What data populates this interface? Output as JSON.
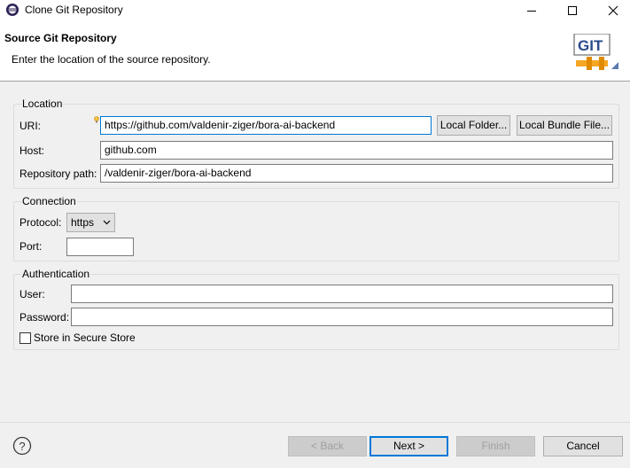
{
  "window": {
    "title": "Clone Git Repository",
    "icon": "eclipse-icon"
  },
  "header": {
    "title": "Source Git Repository",
    "description": "Enter the location of the source repository.",
    "logo_text": "GIT"
  },
  "location": {
    "legend": "Location",
    "uri_label": "URI:",
    "uri_value": "https://github.com/valdenir-ziger/bora-ai-backend",
    "local_folder_button": "Local Folder...",
    "local_bundle_button": "Local Bundle File...",
    "host_label": "Host:",
    "host_value": "github.com",
    "repo_path_label": "Repository path:",
    "repo_path_value": "/valdenir-ziger/bora-ai-backend"
  },
  "connection": {
    "legend": "Connection",
    "protocol_label": "Protocol:",
    "protocol_value": "https",
    "port_label": "Port:",
    "port_value": ""
  },
  "authentication": {
    "legend": "Authentication",
    "user_label": "User:",
    "user_value": "",
    "password_label": "Password:",
    "password_value": "",
    "secure_store_label": "Store in Secure Store",
    "secure_store_checked": false
  },
  "footer": {
    "back_label": "< Back",
    "next_label": "Next >",
    "finish_label": "Finish",
    "cancel_label": "Cancel",
    "help_icon": "help-icon"
  },
  "colors": {
    "focus_blue": "#0078d7",
    "git_orange": "#f5a623"
  }
}
